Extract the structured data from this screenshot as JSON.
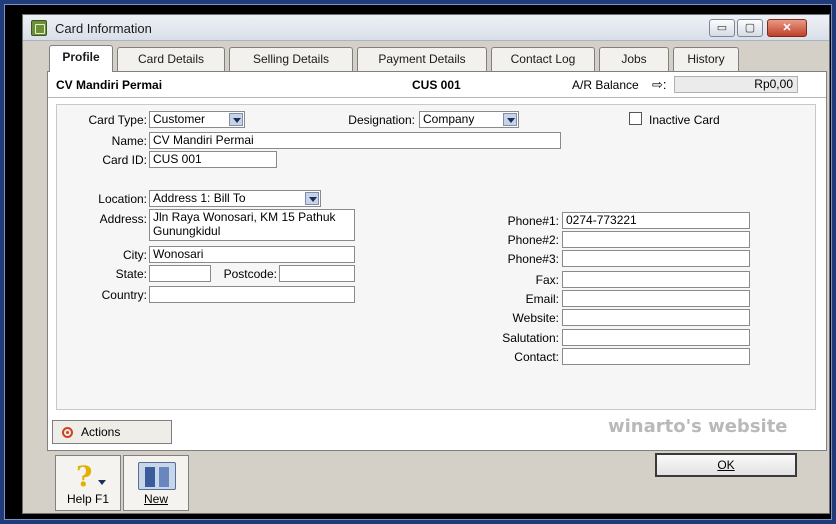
{
  "window": {
    "title": "Card Information",
    "min_label": "▭",
    "max_label": "▢",
    "close_label": "✕"
  },
  "tabs": [
    {
      "label": "Profile",
      "active": true
    },
    {
      "label": "Card Details"
    },
    {
      "label": "Selling Details"
    },
    {
      "label": "Payment Details"
    },
    {
      "label": "Contact Log"
    },
    {
      "label": "Jobs"
    },
    {
      "label": "History"
    }
  ],
  "header": {
    "card_name": "CV Mandiri Permai",
    "card_id": "CUS  001",
    "ar_label": "A/R Balance",
    "ar_arrow": "⇨:",
    "ar_value": "Rp0,00"
  },
  "profile": {
    "card_type_label": "Card Type:",
    "card_type_value": "Customer",
    "designation_label": "Designation:",
    "designation_value": "Company",
    "inactive_label": "Inactive Card",
    "name_label": "Name:",
    "name_value": "CV Mandiri Permai",
    "card_id_label": "Card ID:",
    "card_id_value": "CUS  001",
    "location_label": "Location:",
    "location_value": "Address 1:  Bill To",
    "address_label": "Address:",
    "address_value": "Jln Raya Wonosari, KM 15 Pathuk Gunungkidul",
    "city_label": "City:",
    "city_value": "Wonosari",
    "state_label": "State:",
    "state_value": "",
    "postcode_label": "Postcode:",
    "postcode_value": "",
    "country_label": "Country:",
    "country_value": "",
    "phone1_label": "Phone#1:",
    "phone1_value": "0274-773221",
    "phone2_label": "Phone#2:",
    "phone2_value": "",
    "phone3_label": "Phone#3:",
    "phone3_value": "",
    "fax_label": "Fax:",
    "fax_value": "",
    "email_label": "Email:",
    "email_value": "",
    "website_label": "Website:",
    "website_value": "",
    "salutation_label": "Salutation:",
    "salutation_value": "",
    "contact_label": "Contact:",
    "contact_value": ""
  },
  "actions_label": "Actions",
  "watermark": "winarto's website",
  "buttons": {
    "help_label": "Help F1",
    "new_label": "New",
    "ok_label": "OK"
  },
  "icons": {
    "app": "card-app-icon",
    "actions": "target-icon",
    "help": "question-icon",
    "new": "book-icon"
  }
}
